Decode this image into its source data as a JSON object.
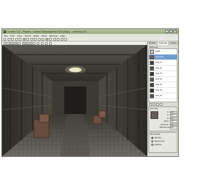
{
  "window": {
    "title": "Unreal 3.0 - Project - Unreal Development Kit (Map) - untitled.ut3",
    "controls": [
      "_",
      "□",
      "x"
    ]
  },
  "menubar": [
    "File",
    "Edit",
    "View",
    "Brush",
    "Build",
    "Tools",
    "Window",
    "Help"
  ],
  "toolbar2": {
    "viewport_mode": "Lit | Perspective",
    "camera_mode": "Perspective"
  },
  "panel": {
    "tabs": [
      "Models",
      "Materials",
      "Scene"
    ],
    "active_tab": "Materials",
    "list_header": "Materials",
    "materials": [
      {
        "name": "Metal",
        "color": "#c9c9c9"
      },
      {
        "name": "Concrete",
        "color": "#6a5c57",
        "selected": true
      },
      {
        "name": "wall_01",
        "color": "#3d3d3d"
      },
      {
        "name": "wall_02",
        "color": "#4e4e4e"
      },
      {
        "name": "wall_03",
        "color": "#333333"
      },
      {
        "name": "wall_04",
        "color": "#5e5e5e"
      },
      {
        "name": "wall_05",
        "color": "#444444"
      },
      {
        "name": "wall_06",
        "color": "#2e2e2e"
      },
      {
        "name": "wall_07",
        "color": "#555555"
      }
    ],
    "editor": {
      "title": "Concrete",
      "properties": [
        {
          "label": "R",
          "value": "0.4"
        },
        {
          "label": "G",
          "value": "0.4"
        },
        {
          "label": "B",
          "value": "0.4"
        },
        {
          "label": "Alpha",
          "value": "1.0"
        },
        {
          "label": "Shininess",
          "value": "0.0"
        },
        {
          "label": "Self Illumination",
          "value": "0.0"
        }
      ]
    },
    "blend": {
      "title": "Blend Mode",
      "options": [
        "Opaque",
        "Translucent",
        "Additive"
      ],
      "selected": "Opaque"
    }
  }
}
